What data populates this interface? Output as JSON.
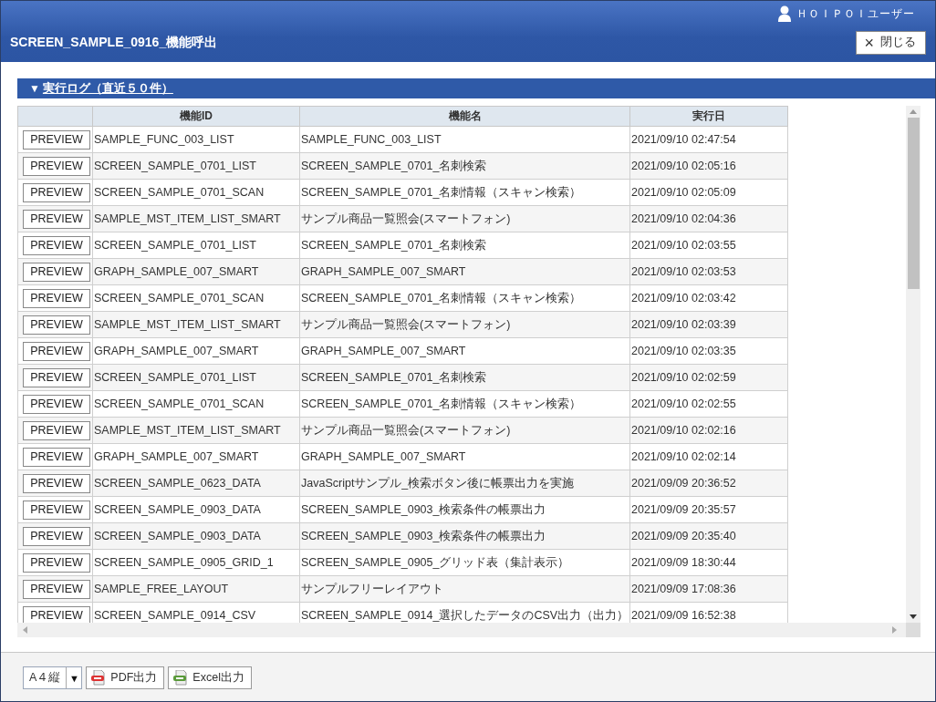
{
  "header": {
    "user": "ＨＯＩＰＯＩユーザー",
    "title": "SCREEN_SAMPLE_0916_機能呼出",
    "close_button": {
      "icon": "×",
      "label": "閉じる"
    }
  },
  "section": {
    "marker": "▼",
    "title": "実行ログ（直近５０件）",
    "expanded": true
  },
  "table": {
    "columns": [
      "",
      "機能ID",
      "機能名",
      "実行日"
    ],
    "rows": [
      {
        "button": "PREVIEW",
        "id": "SAMPLE_FUNC_003_LIST",
        "name": "SAMPLE_FUNC_003_LIST",
        "date": "2021/09/10 02:47:54"
      },
      {
        "button": "PREVIEW",
        "id": "SCREEN_SAMPLE_0701_LIST",
        "name": "SCREEN_SAMPLE_0701_名刺検索",
        "date": "2021/09/10 02:05:16"
      },
      {
        "button": "PREVIEW",
        "id": "SCREEN_SAMPLE_0701_SCAN",
        "name": "SCREEN_SAMPLE_0701_名刺情報（スキャン検索）",
        "date": "2021/09/10 02:05:09"
      },
      {
        "button": "PREVIEW",
        "id": "SAMPLE_MST_ITEM_LIST_SMART",
        "name": "サンプル商品一覧照会(スマートフォン)",
        "date": "2021/09/10 02:04:36"
      },
      {
        "button": "PREVIEW",
        "id": "SCREEN_SAMPLE_0701_LIST",
        "name": "SCREEN_SAMPLE_0701_名刺検索",
        "date": "2021/09/10 02:03:55"
      },
      {
        "button": "PREVIEW",
        "id": "GRAPH_SAMPLE_007_SMART",
        "name": "GRAPH_SAMPLE_007_SMART",
        "date": "2021/09/10 02:03:53"
      },
      {
        "button": "PREVIEW",
        "id": "SCREEN_SAMPLE_0701_SCAN",
        "name": "SCREEN_SAMPLE_0701_名刺情報（スキャン検索）",
        "date": "2021/09/10 02:03:42"
      },
      {
        "button": "PREVIEW",
        "id": "SAMPLE_MST_ITEM_LIST_SMART",
        "name": "サンプル商品一覧照会(スマートフォン)",
        "date": "2021/09/10 02:03:39"
      },
      {
        "button": "PREVIEW",
        "id": "GRAPH_SAMPLE_007_SMART",
        "name": "GRAPH_SAMPLE_007_SMART",
        "date": "2021/09/10 02:03:35"
      },
      {
        "button": "PREVIEW",
        "id": "SCREEN_SAMPLE_0701_LIST",
        "name": "SCREEN_SAMPLE_0701_名刺検索",
        "date": "2021/09/10 02:02:59"
      },
      {
        "button": "PREVIEW",
        "id": "SCREEN_SAMPLE_0701_SCAN",
        "name": "SCREEN_SAMPLE_0701_名刺情報（スキャン検索）",
        "date": "2021/09/10 02:02:55"
      },
      {
        "button": "PREVIEW",
        "id": "SAMPLE_MST_ITEM_LIST_SMART",
        "name": "サンプル商品一覧照会(スマートフォン)",
        "date": "2021/09/10 02:02:16"
      },
      {
        "button": "PREVIEW",
        "id": "GRAPH_SAMPLE_007_SMART",
        "name": "GRAPH_SAMPLE_007_SMART",
        "date": "2021/09/10 02:02:14"
      },
      {
        "button": "PREVIEW",
        "id": "SCREEN_SAMPLE_0623_DATA",
        "name": "JavaScriptサンプル_検索ボタン後に帳票出力を実施",
        "date": "2021/09/09 20:36:52"
      },
      {
        "button": "PREVIEW",
        "id": "SCREEN_SAMPLE_0903_DATA",
        "name": "SCREEN_SAMPLE_0903_検索条件の帳票出力",
        "date": "2021/09/09 20:35:57"
      },
      {
        "button": "PREVIEW",
        "id": "SCREEN_SAMPLE_0903_DATA",
        "name": "SCREEN_SAMPLE_0903_検索条件の帳票出力",
        "date": "2021/09/09 20:35:40"
      },
      {
        "button": "PREVIEW",
        "id": "SCREEN_SAMPLE_0905_GRID_1",
        "name": "SCREEN_SAMPLE_0905_グリッド表（集計表示）",
        "date": "2021/09/09 18:30:44"
      },
      {
        "button": "PREVIEW",
        "id": "SAMPLE_FREE_LAYOUT",
        "name": "サンプルフリーレイアウト",
        "date": "2021/09/09 17:08:36"
      },
      {
        "button": "PREVIEW",
        "id": "SCREEN_SAMPLE_0914_CSV",
        "name": "SCREEN_SAMPLE_0914_選択したデータのCSV出力（出力）",
        "date": "2021/09/09 16:52:38"
      }
    ]
  },
  "footer": {
    "paper_select": {
      "value": "A４縦",
      "arrow": "▼"
    },
    "buttons": [
      {
        "kind": "pdf",
        "label": "PDF出力"
      },
      {
        "kind": "excel",
        "label": "Excel出力"
      }
    ]
  }
}
